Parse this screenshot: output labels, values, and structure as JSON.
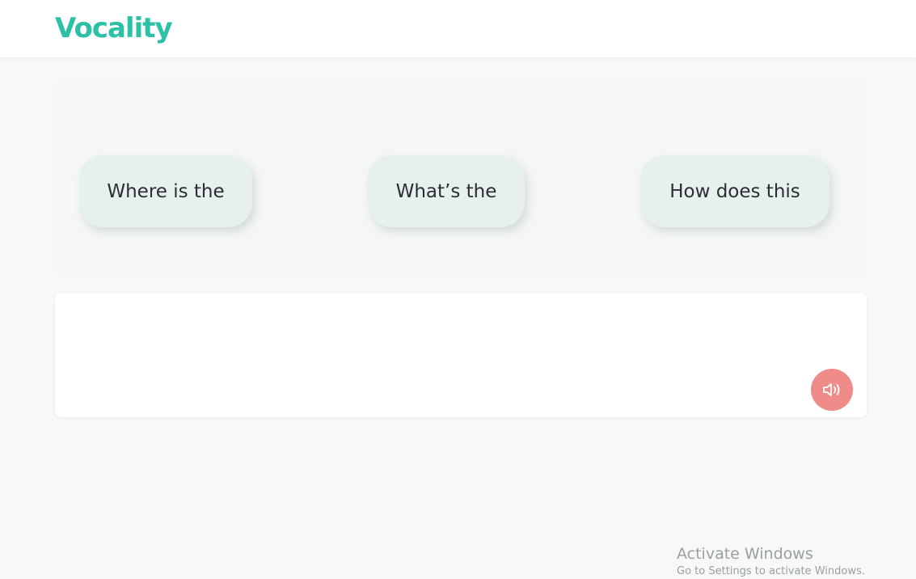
{
  "app": {
    "logo_text": "Vocality",
    "brand_color": "#2bc1a6"
  },
  "suggestions": [
    {
      "label": "Where is the"
    },
    {
      "label": "What’s the"
    },
    {
      "label": "How does this"
    }
  ],
  "input": {
    "value": ""
  },
  "speak_button": {
    "icon": "speaker-icon",
    "color": "#ef8c8a"
  },
  "watermark": {
    "title": "Activate Windows",
    "subtitle": "Go to Settings to activate Windows."
  }
}
